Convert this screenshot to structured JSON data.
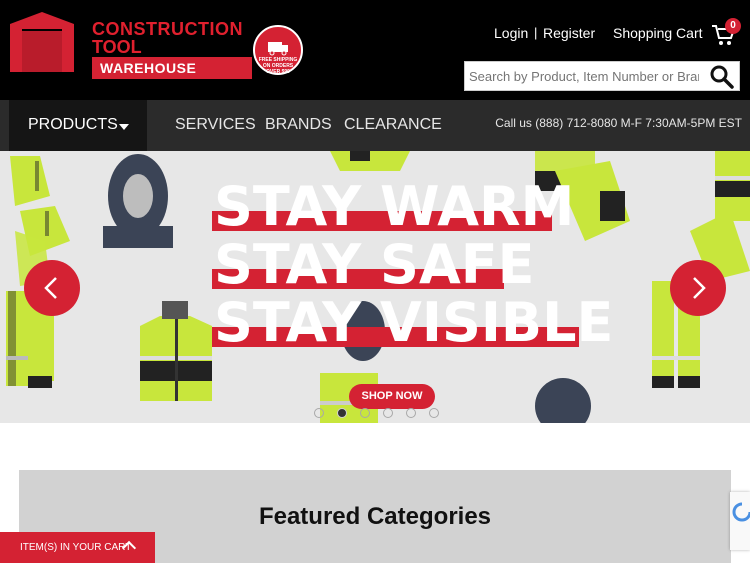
{
  "header": {
    "logo": {
      "line1": "CONSTRUCTION",
      "line2": "TOOL",
      "banner": "WAREHOUSE",
      "badge_text": "FREE SHIPPING ON ORDERS OVER $99"
    },
    "links": {
      "login": "Login",
      "separator": "|",
      "register": "Register",
      "cart": "Shopping Cart"
    },
    "cart_count": "0",
    "search": {
      "placeholder": "Search by Product, Item Number or Brand"
    }
  },
  "nav": {
    "products": "PRODUCTS",
    "items": [
      "SERVICES",
      "BRANDS",
      "CLEARANCE"
    ],
    "phone": "Call us (888) 712-8080 M-F 7:30AM-5PM EST"
  },
  "hero": {
    "lines": [
      "STAY WARM",
      "STAY SAFE",
      "STAY VISIBLE"
    ],
    "cta": "SHOP NOW",
    "slide_count": 6,
    "active_slide": 2
  },
  "featured": {
    "title": "Featured Categories"
  },
  "cart_bar": {
    "label": "ITEM(S) IN YOUR CART"
  },
  "colors": {
    "brand_red": "#d42233",
    "header_bg": "#000000",
    "nav_bg": "#2b2b2b",
    "hi_vis": "#c8e63c"
  }
}
